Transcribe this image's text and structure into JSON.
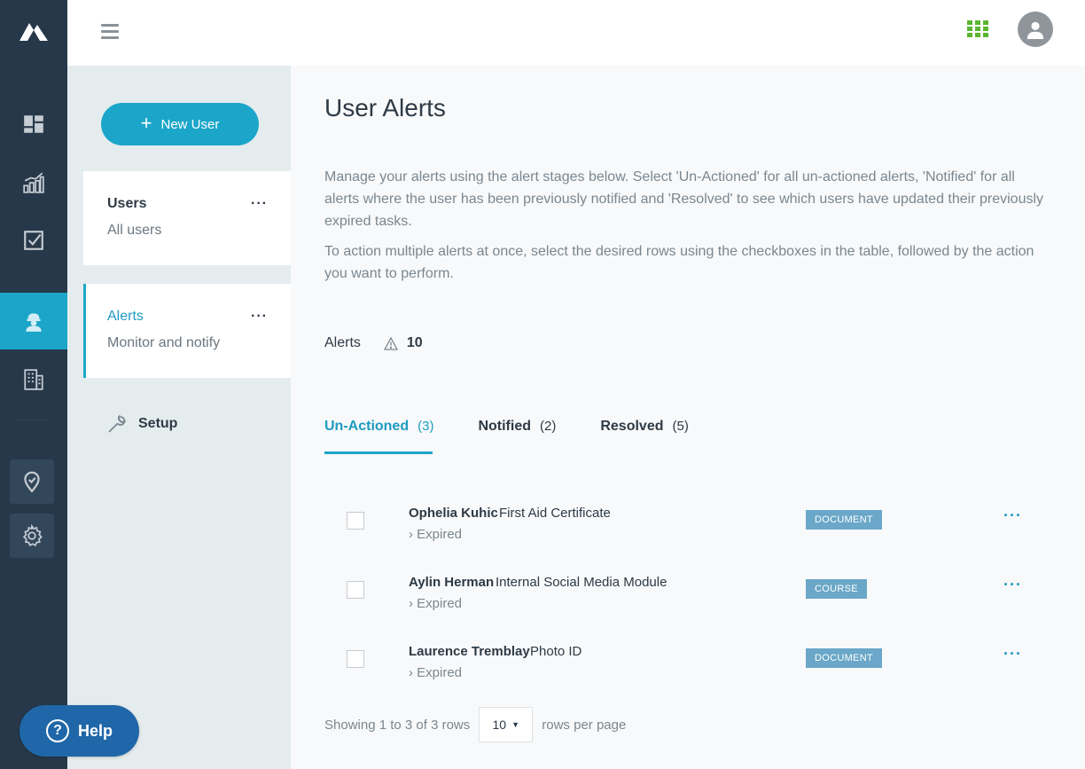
{
  "topbar": {
    "menu_icon": "hamburger-icon",
    "apps_icon": "grid-icon",
    "avatar_icon": "user-icon",
    "apps_color": "#5ab531"
  },
  "rail": {
    "items": [
      {
        "name": "dashboard",
        "icon": "dashboard-icon"
      },
      {
        "name": "reports",
        "icon": "bar-chart-icon"
      },
      {
        "name": "tasks",
        "icon": "checkbox-icon"
      },
      {
        "name": "users",
        "icon": "worker-icon",
        "active": true
      },
      {
        "name": "buildings",
        "icon": "building-icon"
      },
      {
        "name": "locations",
        "icon": "location-pin-icon"
      },
      {
        "name": "settings",
        "icon": "gear-icon"
      }
    ]
  },
  "subnav": {
    "new_user_label": "New User",
    "cards": [
      {
        "title": "Users",
        "subtitle": "All users",
        "more": "···",
        "active": false
      },
      {
        "title": "Alerts",
        "subtitle": "Monitor and notify",
        "more": "···",
        "active": true
      }
    ],
    "setup_label": "Setup"
  },
  "main": {
    "title": "User Alerts",
    "description": [
      "Manage your alerts using the alert stages below. Select 'Un-Actioned' for all un-actioned alerts, 'Notified' for all alerts where the user has been previously notified and 'Resolved' to see which users have updated their previously expired tasks.",
      "To action multiple alerts at once, select the desired rows using the checkboxes in the table, followed by the action you want to perform."
    ],
    "alerts_label": "Alerts",
    "alerts_count": "10",
    "tabs": [
      {
        "label": "Un-Actioned",
        "count": "(3)",
        "active": true
      },
      {
        "label": "Notified",
        "count": "(2)",
        "active": false
      },
      {
        "label": "Resolved",
        "count": "(5)",
        "active": false
      }
    ],
    "rows": [
      {
        "name": "Ophelia Kuhic",
        "item": "First Aid Certificate",
        "status": "› Expired",
        "badge": "DOCUMENT",
        "more": "···"
      },
      {
        "name": "Aylin Herman",
        "item": "Internal Social Media Module",
        "status": "› Expired",
        "badge": "COURSE",
        "more": "···"
      },
      {
        "name": "Laurence Tremblay",
        "item": "Photo ID",
        "status": "› Expired",
        "badge": "DOCUMENT",
        "more": "···"
      }
    ],
    "pager": {
      "showing": "Showing 1 to 3 of 3 rows",
      "per_page_value": "10",
      "per_page_label": "rows per page"
    }
  },
  "help": {
    "label": "Help",
    "icon_glyph": "?"
  },
  "colors": {
    "accent": "#1ba6c9",
    "rail": "#263849",
    "badge": "#6aa7c8",
    "help": "#1f67a8"
  }
}
